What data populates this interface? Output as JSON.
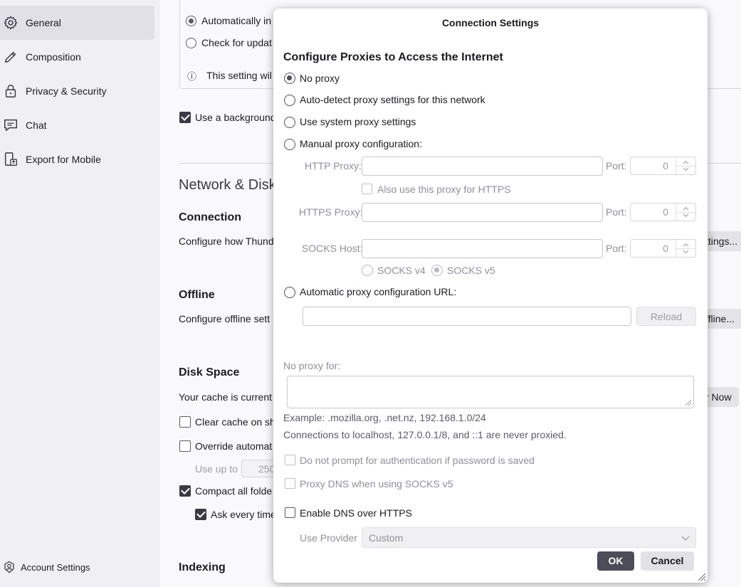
{
  "sidebar": {
    "items": [
      {
        "label": "General",
        "icon": "gear-icon",
        "active": true
      },
      {
        "label": "Composition",
        "icon": "pencil-icon"
      },
      {
        "label": "Privacy & Security",
        "icon": "lock-icon"
      },
      {
        "label": "Chat",
        "icon": "chat-icon"
      },
      {
        "label": "Export for Mobile",
        "icon": "export-mobile-icon"
      }
    ],
    "account_settings": "Account Settings"
  },
  "content": {
    "update_auto": "Automatically in",
    "update_check": "Check for updat",
    "update_note": "This setting wil",
    "use_background": "Use a background",
    "network_heading": "Network & Disk",
    "connection_heading": "Connection",
    "connection_desc": "Configure how Thund",
    "connection_btn": "ttings...",
    "offline_heading": "Offline",
    "offline_desc": "Configure offline sett",
    "offline_btn": "ffline...",
    "disk_heading": "Disk Space",
    "cache_desc": "Your cache is current",
    "clear_now": "r Now",
    "clear_cache": "Clear cache on sh",
    "override": "Override automat",
    "use_up_to": "Use up to",
    "use_up_val": "250",
    "compact": "Compact all folde",
    "ask_every": "Ask every time",
    "indexing_heading": "Indexing"
  },
  "dialog": {
    "title": "Connection Settings",
    "heading": "Configure Proxies to Access the Internet",
    "options": {
      "no_proxy": "No proxy",
      "auto_detect": "Auto-detect proxy settings for this network",
      "system": "Use system proxy settings",
      "manual": "Manual proxy configuration:",
      "auto_url": "Automatic proxy configuration URL:"
    },
    "http_proxy": "HTTP Proxy:",
    "https_proxy": "HTTPS Proxy:",
    "socks_host": "SOCKS Host:",
    "port_label": "Port:",
    "port_value": "0",
    "also_https": "Also use this proxy for HTTPS",
    "socks_v4": "SOCKS v4",
    "socks_v5": "SOCKS v5",
    "reload": "Reload",
    "no_proxy_for": "No proxy for:",
    "example": "Example: .mozilla.org, .net.nz, 192.168.1.0/24",
    "localhost_note": "Connections to localhost, 127.0.0.1/8, and ::1 are never proxied.",
    "no_prompt_auth": "Do not prompt for authentication if password is saved",
    "proxy_dns": "Proxy DNS when using SOCKS v5",
    "enable_doh": "Enable DNS over HTTPS",
    "use_provider": "Use Provider",
    "provider_value": "Custom",
    "ok": "OK",
    "cancel": "Cancel"
  }
}
